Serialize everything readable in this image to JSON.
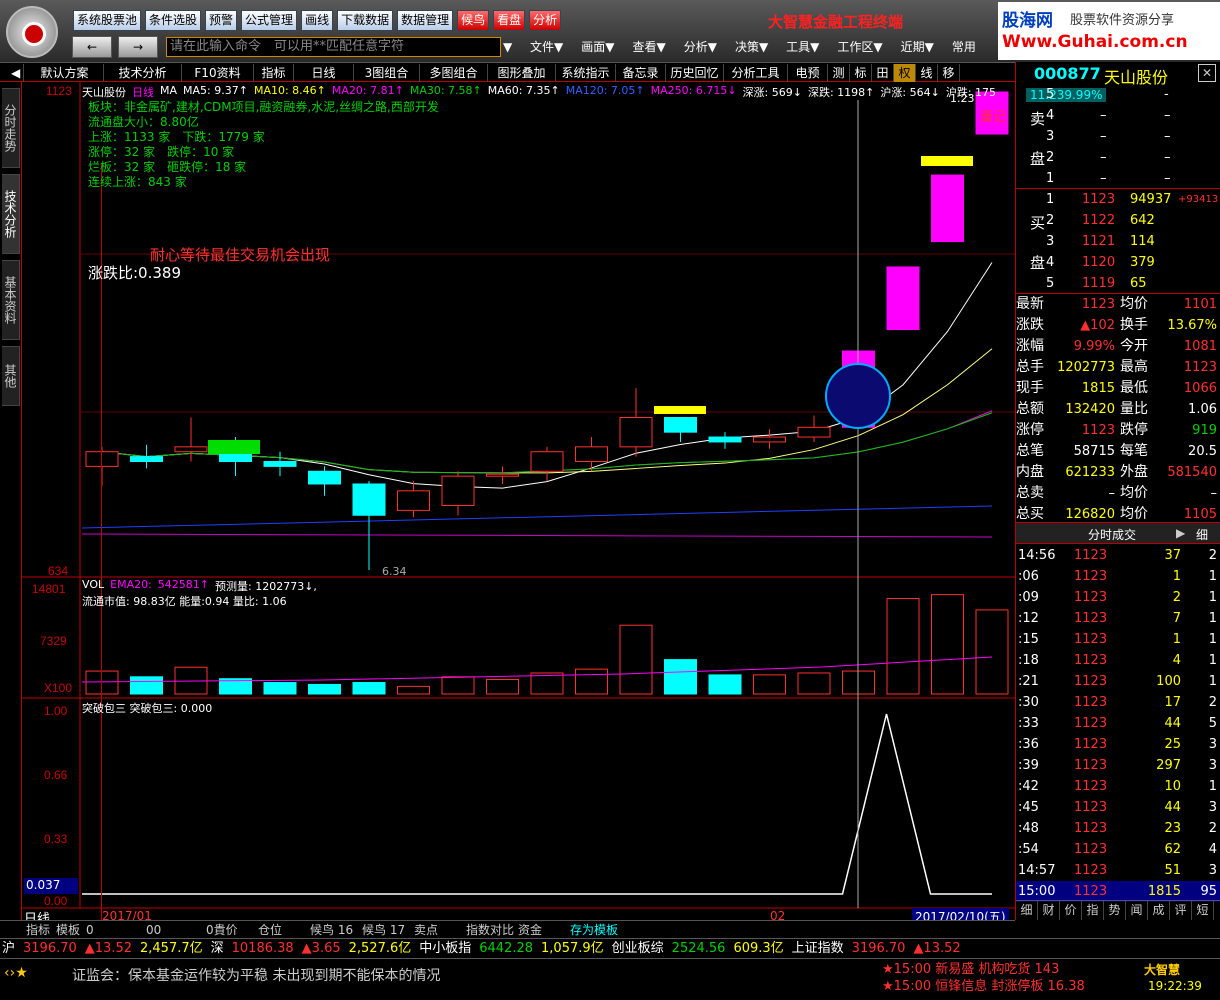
{
  "top_buttons": [
    "系统股票池",
    "条件选股",
    "预警",
    "公式管理",
    "画线",
    "下载数据",
    "数据管理"
  ],
  "top_red_buttons": [
    "候鸟",
    "看盘",
    "分析"
  ],
  "brand": "大智慧金融工程终端",
  "guhai": {
    "line1": "股海网",
    "line1b": "股票软件资源分享",
    "line2": "Www.Guhai.com.cn"
  },
  "nav": {
    "back": "←",
    "forward": "→"
  },
  "command": {
    "placeholder": "请在此输入命令　可以用**匹配任意字符"
  },
  "menus": [
    "文件▼",
    "画面▼",
    "查看▼",
    "分析▼",
    "决策▼",
    "工具▼",
    "工作区▼",
    "近期▼",
    "常用"
  ],
  "toolbar": [
    "默认方案",
    "技术分析",
    "F10资料",
    "指标",
    "日线",
    "3图组合",
    "多图组合",
    "图形叠加",
    "系统指示",
    "备忘录",
    "历史回忆",
    "分析工具",
    "电预",
    "测",
    "标",
    "田",
    "权",
    "线",
    "移"
  ],
  "left_tabs": [
    "分时走势",
    "技术分析",
    "基本资料",
    "其他"
  ],
  "stock": {
    "code": "000877",
    "name": "天山股份",
    "tag": "一",
    "pct_label": "11.239.99%"
  },
  "main_info": {
    "ma_line": [
      "天山股份",
      "日线",
      "MA",
      "MA5: 9.37↑",
      "MA10: 8.46↑",
      "MA20: 7.81↑",
      "MA30: 7.58↑",
      "MA60: 7.35↑",
      "MA120: 7.05↑",
      "MA250: 6.715↓",
      "深涨: 569↓",
      "深跌: 1198↑",
      "沪涨: 564↓",
      "沪跌: 175"
    ],
    "stats": [
      "板块：非金属矿,建材,CDM项目,融资融券,水泥,丝绸之路,西部开发",
      "流通盘大小：8.80亿",
      "上涨：1133 家　下跌：1779 家",
      "涨停：32 家　跌停：10 家",
      "烂板：32 家　砸跌停：18 家",
      "连续上涨：843 家"
    ],
    "slogan": "耐心等待最佳交易机会出现",
    "ratio": "涨跌比:0.389",
    "low_label": "6.34",
    "high_label": "1.23",
    "note": "董记"
  },
  "y_price": {
    "top": "1123",
    "bottom": "634"
  },
  "vol": {
    "header": "VOL",
    "ema": "EMA20:",
    "ema_val": "542581↑",
    "forecast": "预测量: 1202773↓,",
    "line2": "流通市值: 98.83亿 能量:0.94 量比: 1.06",
    "ticks": [
      "14801",
      "7329",
      "X100"
    ]
  },
  "ind": {
    "header": "突破包三 突破包三: 0.000",
    "ticks": [
      "1.00",
      "0.66",
      "0.33",
      "0.037",
      "0.00"
    ]
  },
  "dates": {
    "left": "2017/01",
    "mid": "02",
    "right": "2017/02/10(五)",
    "period": "日线"
  },
  "chart_data": {
    "type": "candlestick",
    "ohlc": [
      [
        7.4,
        7.55,
        7.3,
        7.6,
        7.2
      ],
      [
        7.5,
        7.45,
        7.42,
        7.62,
        7.38
      ],
      [
        7.55,
        7.6,
        7.52,
        7.9,
        7.45
      ],
      [
        7.65,
        7.45,
        7.35,
        7.7,
        7.3
      ],
      [
        7.45,
        7.4,
        7.38,
        7.55,
        7.3
      ],
      [
        7.35,
        7.22,
        7.2,
        7.4,
        7.1
      ],
      [
        7.22,
        6.9,
        6.85,
        7.25,
        6.34
      ],
      [
        6.95,
        7.15,
        6.9,
        7.25,
        6.88
      ],
      [
        7.0,
        7.3,
        6.95,
        7.35,
        6.9
      ],
      [
        7.3,
        7.32,
        7.25,
        7.4,
        7.22
      ],
      [
        7.35,
        7.55,
        7.3,
        7.6,
        7.25
      ],
      [
        7.45,
        7.6,
        7.4,
        7.7,
        7.35
      ],
      [
        7.6,
        7.9,
        7.55,
        8.2,
        7.5
      ],
      [
        7.9,
        7.75,
        7.7,
        7.9,
        7.65
      ],
      [
        7.7,
        7.65,
        7.62,
        7.75,
        7.58
      ],
      [
        7.65,
        7.7,
        7.6,
        7.78,
        7.58
      ],
      [
        7.7,
        7.8,
        7.68,
        7.92,
        7.65
      ],
      [
        7.8,
        8.58,
        7.8,
        8.58,
        7.8
      ],
      [
        8.8,
        9.44,
        8.8,
        9.44,
        8.8
      ],
      [
        9.7,
        10.38,
        9.7,
        10.38,
        9.7
      ],
      [
        10.8,
        11.23,
        10.8,
        11.23,
        10.8
      ]
    ],
    "volume": [
      60,
      45,
      70,
      40,
      30,
      25,
      30,
      20,
      45,
      38,
      55,
      65,
      180,
      90,
      50,
      50,
      55,
      60,
      250,
      260,
      220,
      200
    ],
    "indicator_peak_index": 18
  },
  "right": {
    "sell_label": "卖",
    "sell_label2": "盘",
    "buy_label": "买",
    "buy_label2": "盘",
    "sell": [
      {
        "n": "5",
        "p": "",
        "v": "-"
      },
      {
        "n": "4",
        "p": "–",
        "v": "–"
      },
      {
        "n": "3",
        "p": "–",
        "v": "–"
      },
      {
        "n": "2",
        "p": "–",
        "v": "–"
      },
      {
        "n": "1",
        "p": "–",
        "v": "–"
      }
    ],
    "buy": [
      {
        "n": "1",
        "p": "1123",
        "v": "94937",
        "c": "+93413"
      },
      {
        "n": "2",
        "p": "1122",
        "v": "642"
      },
      {
        "n": "3",
        "p": "1121",
        "v": "114"
      },
      {
        "n": "4",
        "p": "1120",
        "v": "379"
      },
      {
        "n": "5",
        "p": "1119",
        "v": "65"
      }
    ],
    "quote": [
      [
        "最新",
        "1123",
        "均价",
        "1101"
      ],
      [
        "涨跌",
        "▲102",
        "换手",
        "13.67%"
      ],
      [
        "涨幅",
        "9.99%",
        "今开",
        "1081"
      ],
      [
        "总手",
        "1202773",
        "最高",
        "1123"
      ],
      [
        "现手",
        "1815",
        "最低",
        "1066"
      ],
      [
        "总额",
        "132420",
        "量比",
        "1.06"
      ],
      [
        "涨停",
        "1123",
        "跌停",
        "919"
      ],
      [
        "总笔",
        "58715",
        "每笔",
        "20.5"
      ],
      [
        "内盘",
        "621233",
        "外盘",
        "581540"
      ],
      [
        "总卖",
        "–",
        "均价",
        "–"
      ],
      [
        "总买",
        "126820",
        "均价",
        "1105"
      ]
    ],
    "trades_header": "分时成交",
    "trades_tab": "细",
    "trades": [
      [
        "14:56",
        "1123",
        "37",
        "2"
      ],
      [
        ":06",
        "1123",
        "1",
        "1"
      ],
      [
        ":09",
        "1123",
        "2",
        "1"
      ],
      [
        ":12",
        "1123",
        "7",
        "1"
      ],
      [
        ":15",
        "1123",
        "1",
        "1"
      ],
      [
        ":18",
        "1123",
        "4",
        "1"
      ],
      [
        ":21",
        "1123",
        "100",
        "1"
      ],
      [
        ":30",
        "1123",
        "17",
        "2"
      ],
      [
        ":33",
        "1123",
        "44",
        "5"
      ],
      [
        ":36",
        "1123",
        "25",
        "3"
      ],
      [
        ":39",
        "1123",
        "297",
        "3"
      ],
      [
        ":42",
        "1123",
        "10",
        "1"
      ],
      [
        ":45",
        "1123",
        "44",
        "3"
      ],
      [
        ":48",
        "1123",
        "23",
        "2"
      ],
      [
        ":54",
        "1123",
        "62",
        "4"
      ],
      [
        "14:57",
        "1123",
        "51",
        "3"
      ],
      [
        "15:00",
        "1123",
        "1815",
        "95"
      ]
    ],
    "bottom_tabs": [
      "细",
      "财",
      "价",
      "指",
      "势",
      "闻",
      "成",
      "评",
      "短"
    ]
  },
  "bottom_bar": [
    "指标",
    "模板",
    "0",
    "00",
    "0貴价",
    "仓位",
    "候鸟 16",
    "候鸟 17",
    "卖点",
    "指数对比",
    "资金",
    "存为模板"
  ],
  "ticker": [
    {
      "t": "沪",
      "c": "white"
    },
    {
      "t": "3196.70",
      "c": "red"
    },
    {
      "t": "▲13.52",
      "c": "red"
    },
    {
      "t": "2,457.7亿",
      "c": "yellow"
    },
    {
      "t": "深",
      "c": "white"
    },
    {
      "t": "10186.38",
      "c": "red"
    },
    {
      "t": "▲3.65",
      "c": "red"
    },
    {
      "t": "2,527.6亿",
      "c": "yellow"
    },
    {
      "t": "中小板指",
      "c": "white"
    },
    {
      "t": "6442.28",
      "c": "green"
    },
    {
      "t": "1,057.9亿",
      "c": "yellow"
    },
    {
      "t": "创业板综",
      "c": "white"
    },
    {
      "t": "2524.56",
      "c": "green"
    },
    {
      "t": "609.3亿",
      "c": "yellow"
    },
    {
      "t": "上证指数",
      "c": "white"
    },
    {
      "t": "3196.70",
      "c": "red"
    },
    {
      "t": "▲13.52",
      "c": "red"
    }
  ],
  "news": {
    "text": "证监会：保本基金运作较为平稳 未出现到期不能保本的情况",
    "items": [
      {
        "time": "★15:00",
        "text": "新易盛 机构吃货 143"
      },
      {
        "time": "★15:00",
        "text": "恒锋信息 封涨停板 16.38"
      }
    ],
    "clock": "19:22:39",
    "app": "大智慧"
  }
}
